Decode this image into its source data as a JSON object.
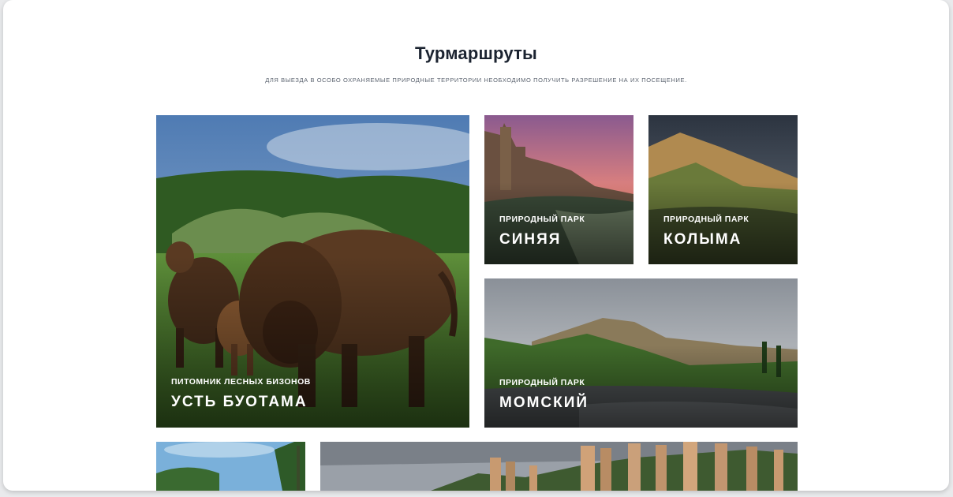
{
  "section": {
    "title": "Турмаршруты",
    "subtitle": "Для выезда в особо охраняемые природные территории необходимо получить разрешение на их посещение."
  },
  "cards": [
    {
      "type": "Питомник лесных бизонов",
      "name": "Усть Буотама",
      "image_icon": "bison-photo"
    },
    {
      "type": "Природный парк",
      "name": "Синяя",
      "image_icon": "rock-pillars-sunset-photo"
    },
    {
      "type": "Природный парк",
      "name": "Колыма",
      "image_icon": "mountain-valley-photo"
    },
    {
      "type": "Природный парк",
      "name": "Момский",
      "image_icon": "mountain-river-photo"
    },
    {
      "type": "",
      "name": "",
      "image_icon": "forest-river-photo"
    },
    {
      "type": "",
      "name": "",
      "image_icon": "lena-pillars-photo"
    }
  ]
}
